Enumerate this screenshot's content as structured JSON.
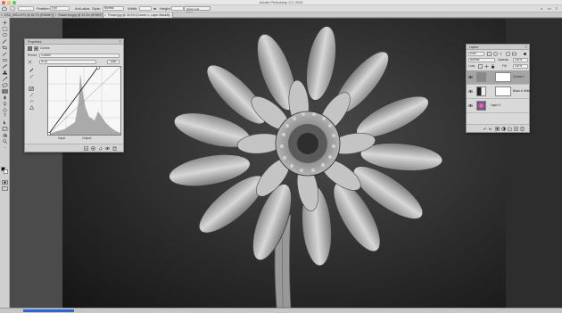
{
  "app": {
    "title": "Adobe Photoshop CC 2019"
  },
  "optionsbar": {
    "feather_label": "Feather:",
    "feather_value": "0 px",
    "antialias_label": "Anti-alias",
    "style_label": "Style:",
    "style_value": "Normal",
    "width_label": "Width:",
    "height_label": "Height:",
    "select_mask_label": "Select and Mask..."
  },
  "tabs": [
    {
      "label": "DSC_0514.JPG @ 16.7% (RGB/8*)"
    },
    {
      "label": "Flower-bw.jpg @ 33.3% (RGB/8*)"
    },
    {
      "label": "Flower.jpg @ 33.3% (Curves 1, Layer Mask/8)"
    }
  ],
  "properties": {
    "title": "Properties",
    "section": "Curves",
    "preset_label": "Preset:",
    "preset_value": "Custom",
    "channel_value": "RGB",
    "auto_label": "Auto",
    "input_label": "Input:",
    "output_label": "Output:"
  },
  "layers": {
    "title": "Layers",
    "kind_label": "Kind",
    "blend_mode": "Normal",
    "opacity_label": "Opacity:",
    "opacity_value": "100%",
    "fill_label": "Fill:",
    "fill_value": "100%",
    "lock_label": "Lock:",
    "rows": [
      {
        "name": "Curves 1"
      },
      {
        "name": "Black & White 1"
      },
      {
        "name": "Layer 0"
      }
    ]
  },
  "status": {
    "progress": 0.09
  }
}
